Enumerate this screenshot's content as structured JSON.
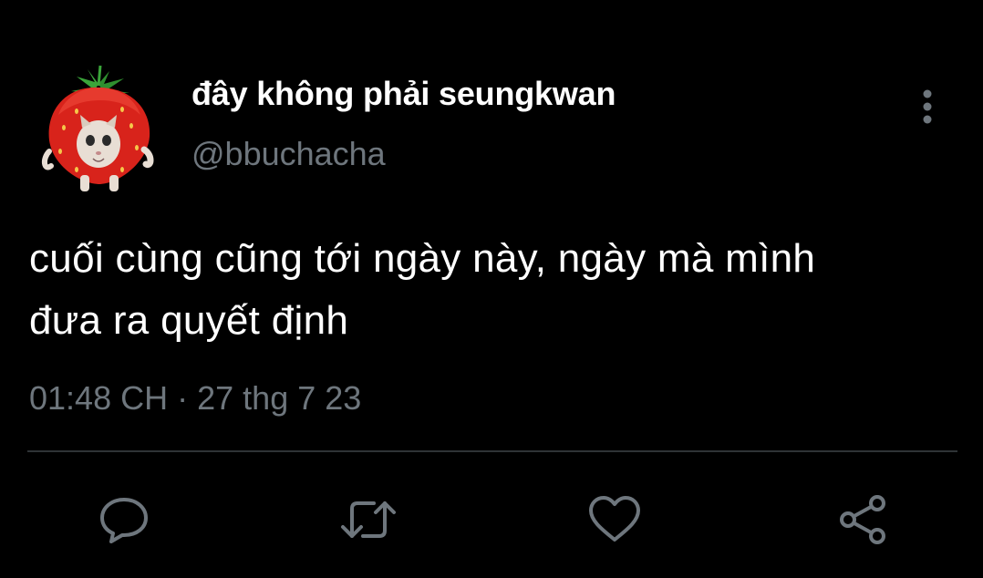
{
  "tweet": {
    "author": {
      "display_name": "đây không phải seungkwan",
      "handle": "@bbuchacha",
      "avatar_icon": "strawberry-cat-avatar"
    },
    "text": "cuối cùng cũng tới ngày này, ngày mà mình\nđưa ra quyết định",
    "time": "01:48 CH",
    "separator": "·",
    "date": "27 thg 7 23"
  },
  "actions": [
    {
      "name": "reply",
      "icon": "comment-icon"
    },
    {
      "name": "retweet",
      "icon": "retweet-icon"
    },
    {
      "name": "like",
      "icon": "heart-icon"
    },
    {
      "name": "share",
      "icon": "share-icon"
    }
  ],
  "colors": {
    "background": "#000000",
    "primary_text": "#ffffff",
    "secondary_text": "#6e767d",
    "divider": "#2f3336",
    "icon": "#6e767d"
  }
}
